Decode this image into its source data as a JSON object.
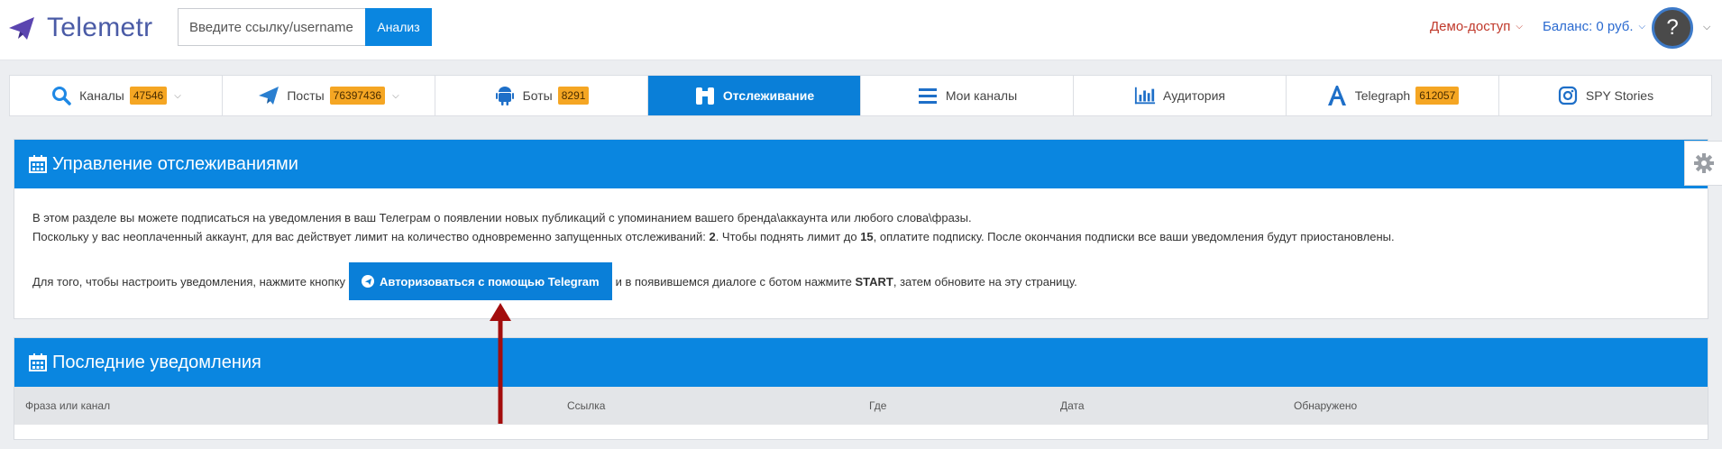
{
  "header": {
    "logo_text": "Telemetr",
    "search_placeholder": "Введите ссылку/username",
    "analyze_label": "Анализ",
    "demo_label": "Демо-доступ",
    "balance_label": "Баланс: 0 руб.",
    "avatar_glyph": "?"
  },
  "nav": {
    "items": [
      {
        "label": "Каналы",
        "badge": "47546",
        "icon": "search-icon"
      },
      {
        "label": "Посты",
        "badge": "76397436",
        "icon": "paper-plane-icon"
      },
      {
        "label": "Боты",
        "badge": "8291",
        "icon": "android-icon"
      },
      {
        "label": "Отслеживание",
        "icon": "binoculars-icon",
        "active": true
      },
      {
        "label": "Мои каналы",
        "icon": "list-icon"
      },
      {
        "label": "Аудитория",
        "icon": "bar-chart-icon"
      },
      {
        "label": "Telegraph",
        "badge": "612057",
        "icon": "letter-a-icon"
      },
      {
        "label": "SPY Stories",
        "icon": "instagram-icon"
      }
    ]
  },
  "tracking_panel": {
    "title": "Управление отслеживаниями",
    "line1": "В этом разделе вы можете подписаться на уведомления в ваш Телеграм о появлении новых публикаций с упоминанием вашего бренда\\аккаунта или любого слова\\фразы.",
    "line2_a": "Поскольку у вас неоплаченный аккаунт, для вас действует лимит на количество одновременно запущенных отслеживаний: ",
    "line2_limit": "2",
    "line2_b": ". Чтобы поднять лимит до ",
    "line2_max": "15",
    "line2_c": ", оплатите подписку. После окончания подписки все ваши уведомления будут приостановлены.",
    "instr_before": "Для того, чтобы настроить уведомления, нажмите кнопку",
    "auth_button": "Авторизоваться с помощью Telegram",
    "instr_after_a": "и в появившемся диалоге с ботом нажмите ",
    "instr_start": "START",
    "instr_after_b": ", затем обновите на эту страницу."
  },
  "notifications_panel": {
    "title": "Последние уведомления",
    "columns": [
      "Фраза или канал",
      "Ссылка",
      "Где",
      "Дата",
      "Обнаружено"
    ]
  },
  "colors": {
    "accent": "#0a86e0",
    "badge": "#f5a623",
    "demo": "#c0392b",
    "arrow": "#a30d0d"
  }
}
